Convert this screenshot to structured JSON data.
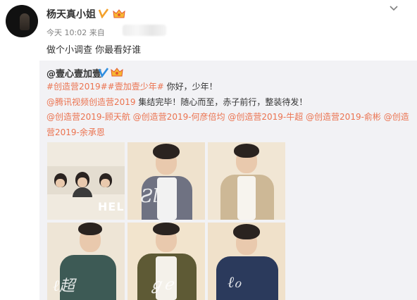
{
  "post": {
    "username": "杨天真小姐",
    "time": "今天 10:02",
    "source_prefix": "来自",
    "text": "做个小调查 你最看好谁"
  },
  "repost": {
    "user": "@壹心壹加壹",
    "line1": {
      "hashtags": "#创造营2019##壹加壹少年#",
      "text": " 你好，少年！"
    },
    "line2": {
      "mention": "@腾讯视频创造营2019",
      "text": " 集结完毕！随心而至，赤子前行，整装待发！"
    },
    "line3": "@创造营2019-顾天航 @创造营2019-何彦倍均 @创造营2019-牛超 @创造营2019-俞彬 @创造",
    "line4": "营2019-余承恩",
    "photo_text": "HEL"
  },
  "colors": {
    "link": "#eb7350",
    "badge": "#f3a12b"
  },
  "icons": [
    "verified-badge-icon",
    "vip-crown-icon",
    "chevron-down-icon"
  ]
}
